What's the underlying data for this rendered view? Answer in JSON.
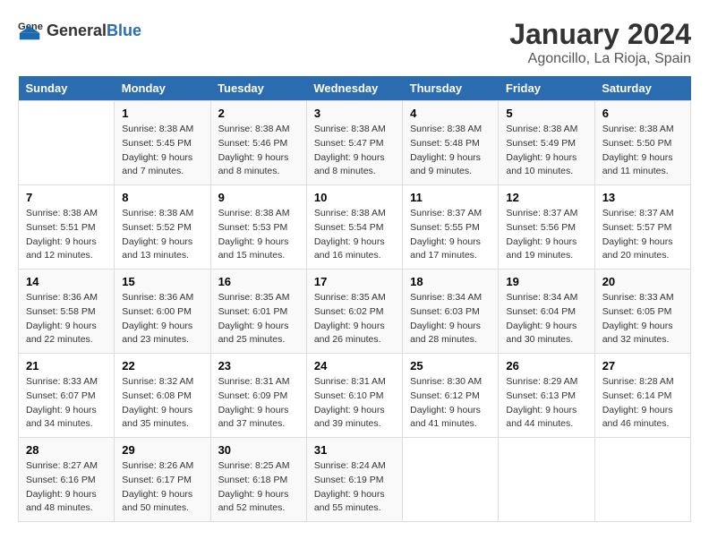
{
  "logo": {
    "general": "General",
    "blue": "Blue"
  },
  "title": "January 2024",
  "subtitle": "Agoncillo, La Rioja, Spain",
  "weekdays": [
    "Sunday",
    "Monday",
    "Tuesday",
    "Wednesday",
    "Thursday",
    "Friday",
    "Saturday"
  ],
  "weeks": [
    [
      {
        "day": "",
        "info": ""
      },
      {
        "day": "1",
        "info": "Sunrise: 8:38 AM\nSunset: 5:45 PM\nDaylight: 9 hours\nand 7 minutes."
      },
      {
        "day": "2",
        "info": "Sunrise: 8:38 AM\nSunset: 5:46 PM\nDaylight: 9 hours\nand 8 minutes."
      },
      {
        "day": "3",
        "info": "Sunrise: 8:38 AM\nSunset: 5:47 PM\nDaylight: 9 hours\nand 8 minutes."
      },
      {
        "day": "4",
        "info": "Sunrise: 8:38 AM\nSunset: 5:48 PM\nDaylight: 9 hours\nand 9 minutes."
      },
      {
        "day": "5",
        "info": "Sunrise: 8:38 AM\nSunset: 5:49 PM\nDaylight: 9 hours\nand 10 minutes."
      },
      {
        "day": "6",
        "info": "Sunrise: 8:38 AM\nSunset: 5:50 PM\nDaylight: 9 hours\nand 11 minutes."
      }
    ],
    [
      {
        "day": "7",
        "info": "Sunrise: 8:38 AM\nSunset: 5:51 PM\nDaylight: 9 hours\nand 12 minutes."
      },
      {
        "day": "8",
        "info": "Sunrise: 8:38 AM\nSunset: 5:52 PM\nDaylight: 9 hours\nand 13 minutes."
      },
      {
        "day": "9",
        "info": "Sunrise: 8:38 AM\nSunset: 5:53 PM\nDaylight: 9 hours\nand 15 minutes."
      },
      {
        "day": "10",
        "info": "Sunrise: 8:38 AM\nSunset: 5:54 PM\nDaylight: 9 hours\nand 16 minutes."
      },
      {
        "day": "11",
        "info": "Sunrise: 8:37 AM\nSunset: 5:55 PM\nDaylight: 9 hours\nand 17 minutes."
      },
      {
        "day": "12",
        "info": "Sunrise: 8:37 AM\nSunset: 5:56 PM\nDaylight: 9 hours\nand 19 minutes."
      },
      {
        "day": "13",
        "info": "Sunrise: 8:37 AM\nSunset: 5:57 PM\nDaylight: 9 hours\nand 20 minutes."
      }
    ],
    [
      {
        "day": "14",
        "info": "Sunrise: 8:36 AM\nSunset: 5:58 PM\nDaylight: 9 hours\nand 22 minutes."
      },
      {
        "day": "15",
        "info": "Sunrise: 8:36 AM\nSunset: 6:00 PM\nDaylight: 9 hours\nand 23 minutes."
      },
      {
        "day": "16",
        "info": "Sunrise: 8:35 AM\nSunset: 6:01 PM\nDaylight: 9 hours\nand 25 minutes."
      },
      {
        "day": "17",
        "info": "Sunrise: 8:35 AM\nSunset: 6:02 PM\nDaylight: 9 hours\nand 26 minutes."
      },
      {
        "day": "18",
        "info": "Sunrise: 8:34 AM\nSunset: 6:03 PM\nDaylight: 9 hours\nand 28 minutes."
      },
      {
        "day": "19",
        "info": "Sunrise: 8:34 AM\nSunset: 6:04 PM\nDaylight: 9 hours\nand 30 minutes."
      },
      {
        "day": "20",
        "info": "Sunrise: 8:33 AM\nSunset: 6:05 PM\nDaylight: 9 hours\nand 32 minutes."
      }
    ],
    [
      {
        "day": "21",
        "info": "Sunrise: 8:33 AM\nSunset: 6:07 PM\nDaylight: 9 hours\nand 34 minutes."
      },
      {
        "day": "22",
        "info": "Sunrise: 8:32 AM\nSunset: 6:08 PM\nDaylight: 9 hours\nand 35 minutes."
      },
      {
        "day": "23",
        "info": "Sunrise: 8:31 AM\nSunset: 6:09 PM\nDaylight: 9 hours\nand 37 minutes."
      },
      {
        "day": "24",
        "info": "Sunrise: 8:31 AM\nSunset: 6:10 PM\nDaylight: 9 hours\nand 39 minutes."
      },
      {
        "day": "25",
        "info": "Sunrise: 8:30 AM\nSunset: 6:12 PM\nDaylight: 9 hours\nand 41 minutes."
      },
      {
        "day": "26",
        "info": "Sunrise: 8:29 AM\nSunset: 6:13 PM\nDaylight: 9 hours\nand 44 minutes."
      },
      {
        "day": "27",
        "info": "Sunrise: 8:28 AM\nSunset: 6:14 PM\nDaylight: 9 hours\nand 46 minutes."
      }
    ],
    [
      {
        "day": "28",
        "info": "Sunrise: 8:27 AM\nSunset: 6:16 PM\nDaylight: 9 hours\nand 48 minutes."
      },
      {
        "day": "29",
        "info": "Sunrise: 8:26 AM\nSunset: 6:17 PM\nDaylight: 9 hours\nand 50 minutes."
      },
      {
        "day": "30",
        "info": "Sunrise: 8:25 AM\nSunset: 6:18 PM\nDaylight: 9 hours\nand 52 minutes."
      },
      {
        "day": "31",
        "info": "Sunrise: 8:24 AM\nSunset: 6:19 PM\nDaylight: 9 hours\nand 55 minutes."
      },
      {
        "day": "",
        "info": ""
      },
      {
        "day": "",
        "info": ""
      },
      {
        "day": "",
        "info": ""
      }
    ]
  ]
}
